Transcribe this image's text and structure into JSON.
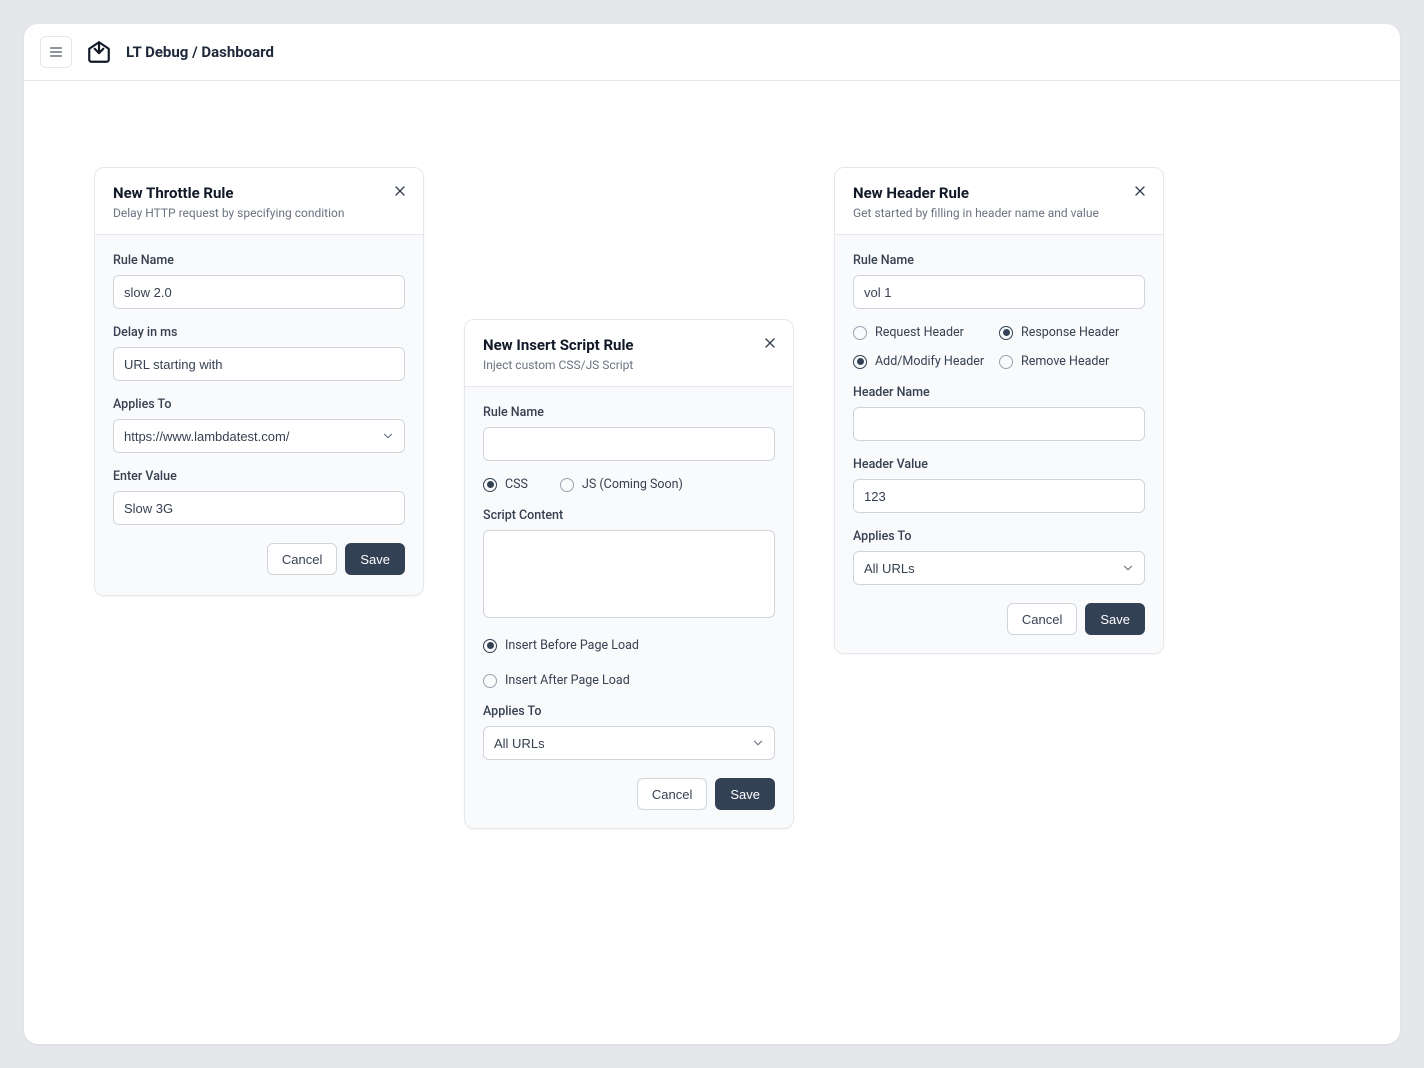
{
  "header": {
    "app_title": "LT Debug / Dashboard"
  },
  "throttle_card": {
    "title": "New Throttle Rule",
    "subtitle": "Delay HTTP request by specifying condition",
    "rule_name_label": "Rule Name",
    "rule_name_value": "slow 2.0",
    "delay_label": "Delay in ms",
    "delay_value": "URL starting with",
    "applies_to_label": "Applies To",
    "applies_to_value": "https://www.lambdatest.com/",
    "enter_value_label": "Enter Value",
    "enter_value_value": "Slow 3G",
    "cancel_label": "Cancel",
    "save_label": "Save"
  },
  "script_card": {
    "title": "New Insert Script Rule",
    "subtitle": "Inject custom CSS/JS Script",
    "rule_name_label": "Rule Name",
    "rule_name_value": "",
    "radio_css": "CSS",
    "radio_js": "JS (Coming Soon)",
    "script_content_label": "Script Content",
    "script_content_value": "",
    "radio_before": "Insert Before Page Load",
    "radio_after": "Insert After Page Load",
    "applies_to_label": "Applies To",
    "applies_to_value": "All URLs",
    "cancel_label": "Cancel",
    "save_label": "Save"
  },
  "header_card": {
    "title": "New Header Rule",
    "subtitle": "Get started by filling in header name and value",
    "rule_name_label": "Rule Name",
    "rule_name_value": "vol 1",
    "radio_request": "Request Header",
    "radio_response": "Response Header",
    "radio_add": "Add/Modify Header",
    "radio_remove": "Remove Header",
    "header_name_label": "Header Name",
    "header_name_value": "",
    "header_value_label": "Header Value",
    "header_value_value": "123",
    "applies_to_label": "Applies To",
    "applies_to_value": "All URLs",
    "cancel_label": "Cancel",
    "save_label": "Save"
  }
}
